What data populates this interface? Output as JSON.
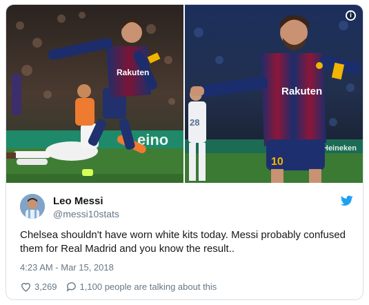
{
  "media": {
    "left_photo_sign": "eino",
    "shirt_sponsor_left": "Rakuten",
    "shirt_sponsor_right": "Rakuten",
    "ad_board_right": "Heineken",
    "player_number_right": "10",
    "opponent_number": "28"
  },
  "author": {
    "name": "Leo Messi",
    "handle": "@messi10stats"
  },
  "tweet": {
    "text": "Chelsea shouldn't have worn white kits today. Messi probably confused them for Real Madrid and you know the result..",
    "timestamp": "4:23 AM - Mar 15, 2018"
  },
  "actions": {
    "likes": "3,269",
    "conversation": "1,100 people are talking about this"
  },
  "colors": {
    "twitter_blue": "#1da1f2",
    "secondary_text": "#657786",
    "primary_text": "#14171a",
    "border": "#d8dee3"
  },
  "icons": {
    "info": "info-icon",
    "bird": "twitter-bird-icon",
    "like": "heart-icon",
    "reply": "speech-bubble-icon"
  }
}
